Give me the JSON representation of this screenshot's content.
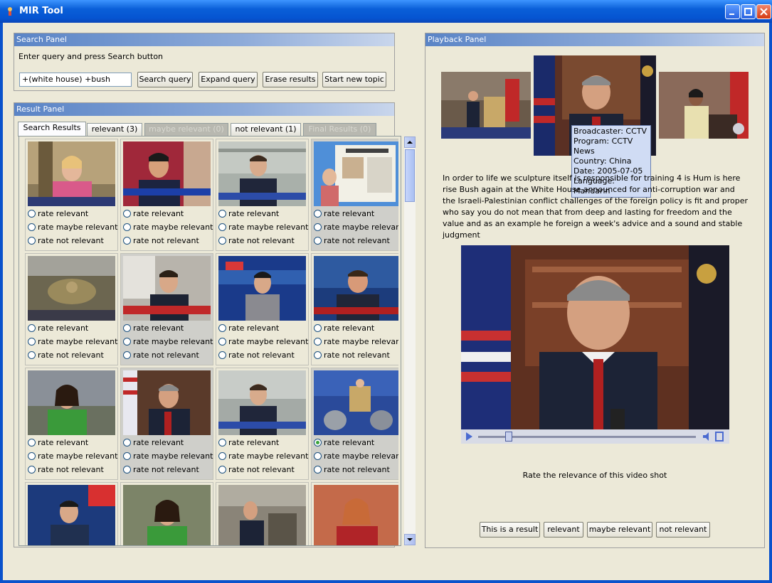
{
  "window": {
    "title": "MIR Tool"
  },
  "search_panel": {
    "title": "Search Panel",
    "hint": "Enter query and press Search button",
    "query_value": "+(white house) +bush",
    "buttons": {
      "search": "Search query",
      "expand": "Expand query",
      "erase": "Erase results",
      "new_topic": "Start new topic"
    }
  },
  "result_panel": {
    "title": "Result Panel",
    "tabs": [
      {
        "label": "Search Results",
        "state": "active"
      },
      {
        "label": "relevant (3)",
        "state": "normal"
      },
      {
        "label": "maybe relevant (0)",
        "state": "disabled"
      },
      {
        "label": "not relevant (1)",
        "state": "normal"
      },
      {
        "label": "Final Results (0)",
        "state": "disabled"
      }
    ],
    "rate_labels": {
      "relevant": "rate relevant",
      "maybe": "rate maybe relevant",
      "not": "rate not relevant"
    }
  },
  "playback_panel": {
    "title": "Playback Panel",
    "tooltip": {
      "broadcaster": "Broadcaster: CCTV",
      "program": "Program: CCTV News",
      "country": "Country: China",
      "date": "Date: 2005-07-05",
      "language": "Language: Mandarin"
    },
    "transcript": "In order to life we sculpture itself is responsible for training 4 is Hum is here rise Bush again at the White House announced for anti-corruption war and the Israeli-Palestinian conflict challenges of the foreign policy is fit and proper who say you do not mean that from deep and lasting for freedom and the value and as an example he foreign a week's advice and a sound and stable judgment",
    "rate_prompt": "Rate the relevance of this video shot",
    "rate_buttons": {
      "result": "This is a result",
      "relevant": "relevant",
      "maybe": "maybe relevant",
      "not": "not relevant"
    },
    "player_progress": 0.13
  },
  "colors": {
    "title_bar": "#0554d1",
    "panel_header": "#5a84c6",
    "selected_radio": "#3aa43a"
  }
}
